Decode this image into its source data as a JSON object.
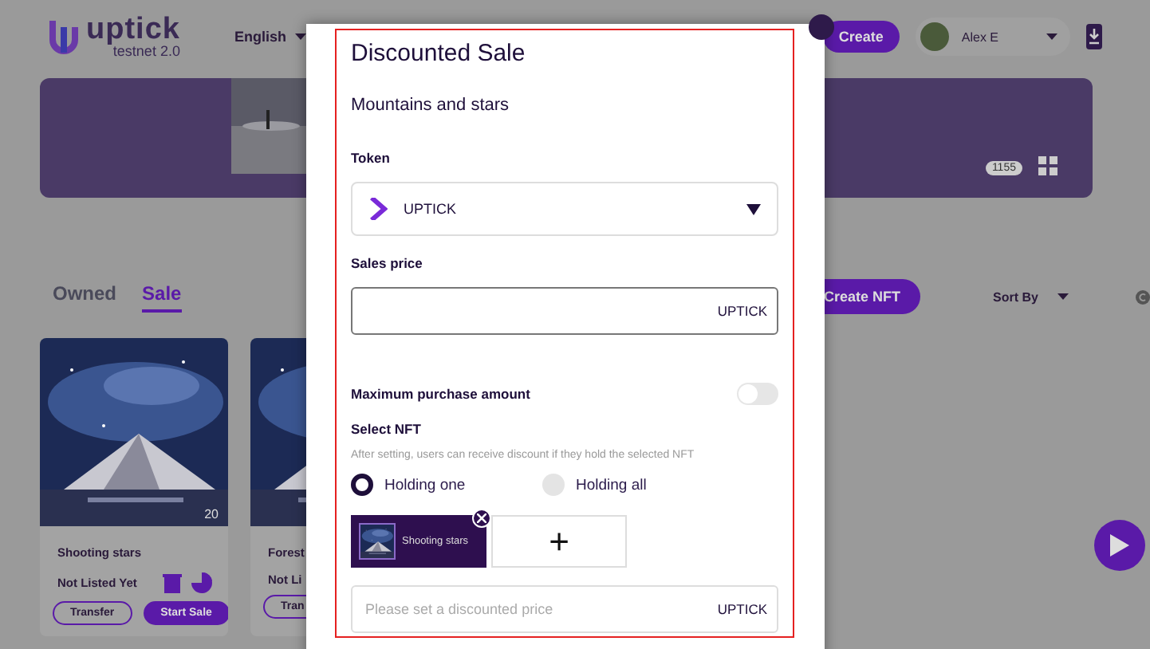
{
  "header": {
    "logo": "uptick",
    "network": "testnet 2.0",
    "language": "English",
    "create_button": "Create",
    "user": "Alex E"
  },
  "banner": {
    "count": "1155"
  },
  "tabs": [
    {
      "label": "Owned",
      "selected": false
    },
    {
      "label": "Sale",
      "selected": true
    }
  ],
  "create_nft_button": "Create NFT",
  "sort": {
    "label": "Sort By"
  },
  "cards": [
    {
      "title": "Shooting stars",
      "count": "20",
      "status": "Not Listed Yet",
      "transfer": "Transfer",
      "start_sale": "Start Sale"
    },
    {
      "title": "Forest",
      "status": "Not Li",
      "transfer": "Tran"
    }
  ],
  "modal": {
    "title": "Discounted Sale",
    "subtitle": "Mountains and stars",
    "token": {
      "label": "Token",
      "value": "UPTICK"
    },
    "sales_price": {
      "label": "Sales price",
      "unit": "UPTICK"
    },
    "max_purchase": {
      "label": "Maximum purchase amount",
      "on": false
    },
    "select_nft": {
      "label": "Select NFT",
      "hint": "After setting, users can receive discount if they hold the selected NFT",
      "options": [
        {
          "label": "Holding one",
          "selected": true
        },
        {
          "label": "Holding all",
          "selected": false
        }
      ],
      "chips": [
        {
          "name": "Shooting stars"
        }
      ],
      "add": "+"
    },
    "discount_price": {
      "placeholder": "Please set a discounted price",
      "unit": "UPTICK"
    }
  }
}
